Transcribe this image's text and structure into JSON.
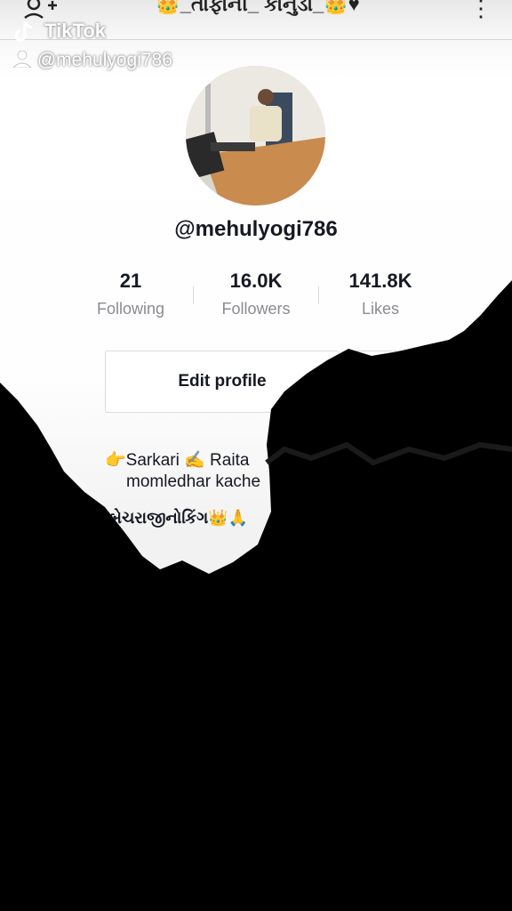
{
  "header": {
    "title": "👑_તાફાની_ કાનુડો_👑♥"
  },
  "watermark": {
    "brand": "TikTok",
    "username": "@mehulyogi786"
  },
  "profile": {
    "username": "@mehulyogi786",
    "stats": [
      {
        "value": "21",
        "label": "Following"
      },
      {
        "value": "16.0K",
        "label": "Followers"
      },
      {
        "value": "141.8K",
        "label": "Likes"
      }
    ],
    "edit_label": "Edit profile",
    "bio": {
      "line1": "👉Sarkari ✍️ Raita",
      "line2": "momledhar kache",
      "line3": "~બેચરાજીનોકિંગ👑🙏"
    }
  },
  "colors": {
    "text": "#161823",
    "muted": "#8a8b91",
    "overlay": "#000000"
  },
  "icons": [
    "add-user-icon",
    "more-icon",
    "tiktok-logo-icon",
    "user-icon",
    "bookmark-icon"
  ]
}
